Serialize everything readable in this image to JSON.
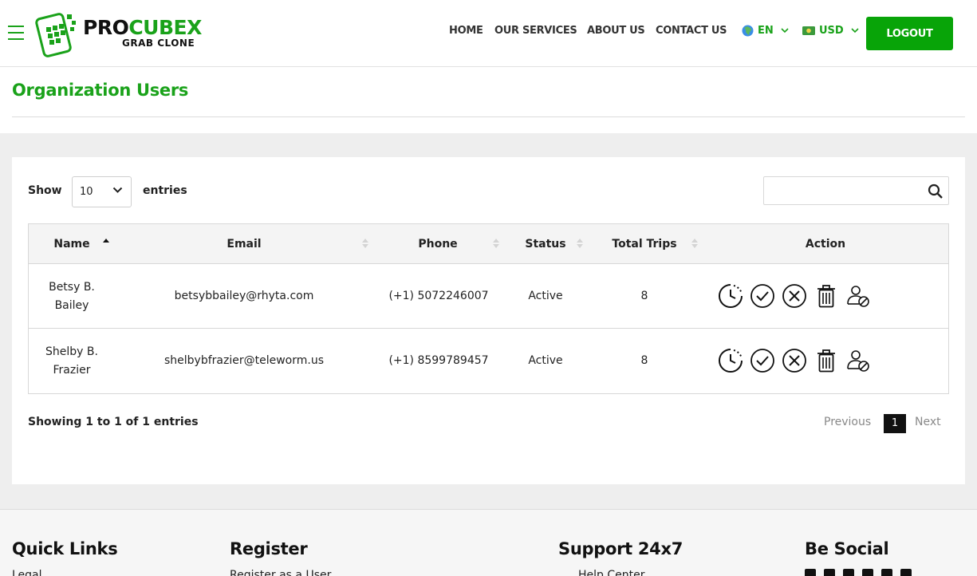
{
  "header": {
    "logo_main_a": "PRO",
    "logo_main_b": "CUBEX",
    "logo_sub": "GRAB CLONE",
    "nav": [
      "HOME",
      "OUR SERVICES",
      "ABOUT US",
      "CONTACT US"
    ],
    "language": "EN",
    "currency": "USD",
    "logout_label": "LOGOUT"
  },
  "page_title": "Organization Users",
  "controls": {
    "show_label": "Show",
    "entries_value": "10",
    "entries_label": "entries",
    "search_value": ""
  },
  "table": {
    "columns": [
      "Name",
      "Email",
      "Phone",
      "Status",
      "Total Trips",
      "Action"
    ],
    "rows": [
      {
        "name_line1": "Betsy B.",
        "name_line2": "Bailey",
        "email": "betsybbailey@rhyta.com",
        "phone": "(+1) 5072246007",
        "status": "Active",
        "trips": "8"
      },
      {
        "name_line1": "Shelby B.",
        "name_line2": "Frazier",
        "email": "shelbybfrazier@teleworm.us",
        "phone": "(+1) 8599789457",
        "status": "Active",
        "trips": "8"
      }
    ],
    "action_icons": [
      "clock-icon",
      "check-circle-icon",
      "x-circle-icon",
      "trash-icon",
      "user-block-icon"
    ]
  },
  "pagination": {
    "info": "Showing 1 to 1 of 1 entries",
    "previous": "Previous",
    "current_page": "1",
    "next": "Next"
  },
  "footer": {
    "headings": [
      "Quick Links",
      "Register",
      "Support 24x7",
      "Be Social"
    ],
    "links": [
      "Legal",
      "Register as a User",
      "Help Center"
    ]
  },
  "colors": {
    "brand_green": "#1aa21a",
    "button_green": "#08a408"
  }
}
